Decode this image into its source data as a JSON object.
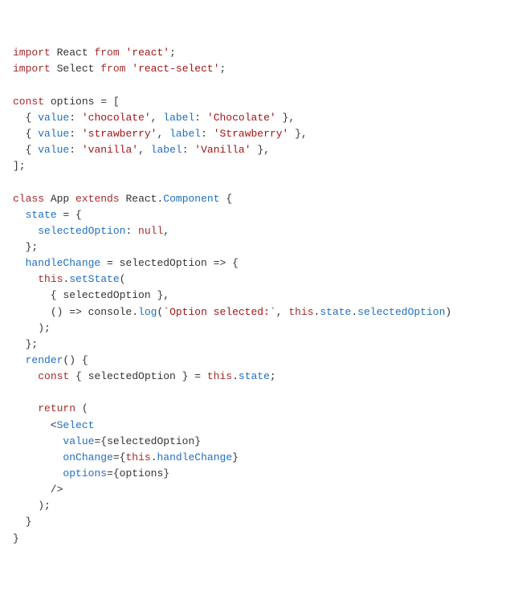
{
  "code": {
    "line01": {
      "import": "import",
      "react": "React",
      "from": "from",
      "reactStr": "'react'",
      "semi": ";"
    },
    "line02": {
      "import": "import",
      "select": "Select",
      "from": "from",
      "selectStr": "'react-select'",
      "semi": ";"
    },
    "line04": {
      "const": "const",
      "options": "options",
      "assign": " = ["
    },
    "line05": {
      "open": "  { ",
      "valueKey": "value",
      "c1": ": ",
      "valueStr": "'chocolate'",
      "c2": ", ",
      "labelKey": "label",
      "c3": ": ",
      "labelStr": "'Chocolate'",
      "close": " },"
    },
    "line06": {
      "open": "  { ",
      "valueKey": "value",
      "c1": ": ",
      "valueStr": "'strawberry'",
      "c2": ", ",
      "labelKey": "label",
      "c3": ": ",
      "labelStr": "'Strawberry'",
      "close": " },"
    },
    "line07": {
      "open": "  { ",
      "valueKey": "value",
      "c1": ": ",
      "valueStr": "'vanilla'",
      "c2": ", ",
      "labelKey": "label",
      "c3": ": ",
      "labelStr": "'Vanilla'",
      "close": " },"
    },
    "line08": {
      "close": "];"
    },
    "line10": {
      "class": "class",
      "app": "App",
      "extends": "extends",
      "react": "React",
      "dot": ".",
      "component": "Component",
      "brace": " {"
    },
    "line11": {
      "indent": "  ",
      "state": "state",
      "eq": " = {"
    },
    "line12": {
      "indent": "    ",
      "selOpt": "selectedOption",
      "colon": ": ",
      "null": "null",
      "comma": ","
    },
    "line13": {
      "close": "  };"
    },
    "line14": {
      "indent": "  ",
      "handle": "handleChange",
      "eq": " = ",
      "param": "selectedOption",
      "arrow": " => {"
    },
    "line15": {
      "indent": "    ",
      "this": "this",
      "dot": ".",
      "setState": "setState",
      "open": "("
    },
    "line16": {
      "indent": "      { ",
      "selOpt": "selectedOption",
      "close": " },"
    },
    "line17": {
      "indent": "      ",
      "arrow": "() => ",
      "console": "console",
      "dot1": ".",
      "log": "log",
      "open": "(",
      "tmpl": "`Option selected:`",
      "comma": ", ",
      "this": "this",
      "dot2": ".",
      "state": "state",
      "dot3": ".",
      "selOpt": "selectedOption",
      "close": ")"
    },
    "line18": {
      "close": "    );"
    },
    "line19": {
      "close": "  };"
    },
    "line20": {
      "indent": "  ",
      "render": "render",
      "paren": "() {"
    },
    "line21": {
      "indent": "    ",
      "const": "const",
      "open": " { ",
      "selOpt": "selectedOption",
      "close": " } = ",
      "this": "this",
      "dot": ".",
      "state": "state",
      "semi": ";"
    },
    "line23": {
      "indent": "    ",
      "return": "return",
      "open": " ("
    },
    "line24": {
      "indent": "      <",
      "select": "Select"
    },
    "line25": {
      "indent": "        ",
      "attr": "value",
      "eq": "=",
      "open": "{",
      "val": "selectedOption",
      "close": "}"
    },
    "line26": {
      "indent": "        ",
      "attr": "onChange",
      "eq": "=",
      "open": "{",
      "this": "this",
      "dot": ".",
      "handle": "handleChange",
      "close": "}"
    },
    "line27": {
      "indent": "        ",
      "attr": "options",
      "eq": "=",
      "open": "{",
      "val": "options",
      "close": "}"
    },
    "line28": {
      "close": "      />"
    },
    "line29": {
      "close": "    );"
    },
    "line30": {
      "close": "  }"
    },
    "line31": {
      "close": "}"
    }
  }
}
